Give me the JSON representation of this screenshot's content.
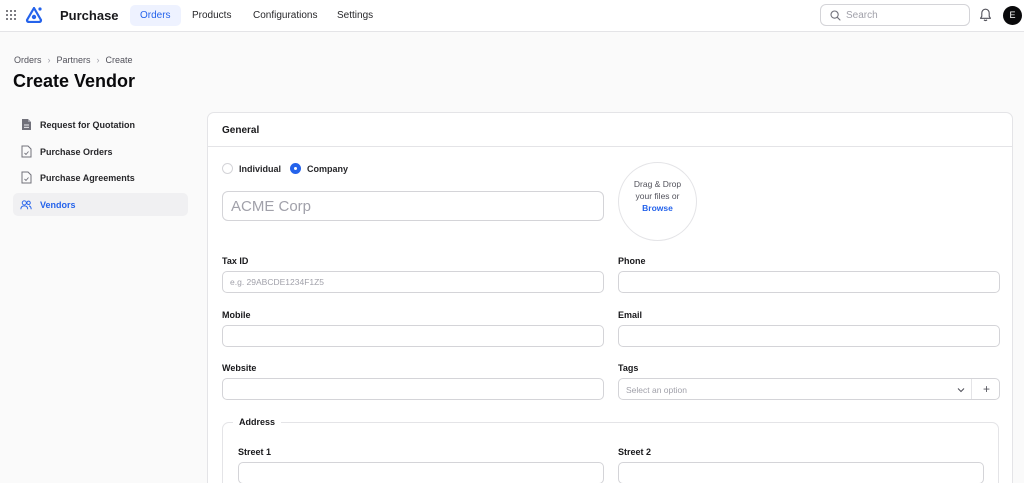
{
  "app": {
    "title": "Purchase"
  },
  "nav": {
    "items": [
      {
        "label": "Orders",
        "active": true
      },
      {
        "label": "Products",
        "active": false
      },
      {
        "label": "Configurations",
        "active": false
      },
      {
        "label": "Settings",
        "active": false
      }
    ]
  },
  "search": {
    "placeholder": "Search"
  },
  "user": {
    "initial": "E"
  },
  "breadcrumb": {
    "items": [
      "Orders",
      "Partners",
      "Create"
    ]
  },
  "page": {
    "title": "Create Vendor"
  },
  "sidebar": {
    "items": [
      {
        "label": "Request for Quotation",
        "icon": "document-icon",
        "active": false
      },
      {
        "label": "Purchase Orders",
        "icon": "document-check-icon",
        "active": false
      },
      {
        "label": "Purchase Agreements",
        "icon": "document-check-icon",
        "active": false
      },
      {
        "label": "Vendors",
        "icon": "users-icon",
        "active": true
      }
    ]
  },
  "form": {
    "section_title": "General",
    "type_options": [
      {
        "label": "Individual",
        "checked": false
      },
      {
        "label": "Company",
        "checked": true
      }
    ],
    "name": {
      "value": "",
      "placeholder": "ACME Corp"
    },
    "upload": {
      "text": "Drag & Drop your files or",
      "link": "Browse"
    },
    "fields": {
      "tax_id": {
        "label": "Tax ID",
        "placeholder": "e.g. 29ABCDE1234F1Z5",
        "value": ""
      },
      "phone": {
        "label": "Phone",
        "placeholder": "",
        "value": ""
      },
      "mobile": {
        "label": "Mobile",
        "placeholder": "",
        "value": ""
      },
      "email": {
        "label": "Email",
        "placeholder": "",
        "value": ""
      },
      "website": {
        "label": "Website",
        "placeholder": "",
        "value": ""
      },
      "tags": {
        "label": "Tags",
        "placeholder": "Select an option",
        "add_label": "+"
      }
    },
    "address": {
      "legend": "Address",
      "street1": {
        "label": "Street 1",
        "value": ""
      },
      "street2": {
        "label": "Street 2",
        "value": ""
      }
    }
  },
  "colors": {
    "accent": "#2563eb",
    "border": "#d4d4d8",
    "background": "#fafafa"
  }
}
